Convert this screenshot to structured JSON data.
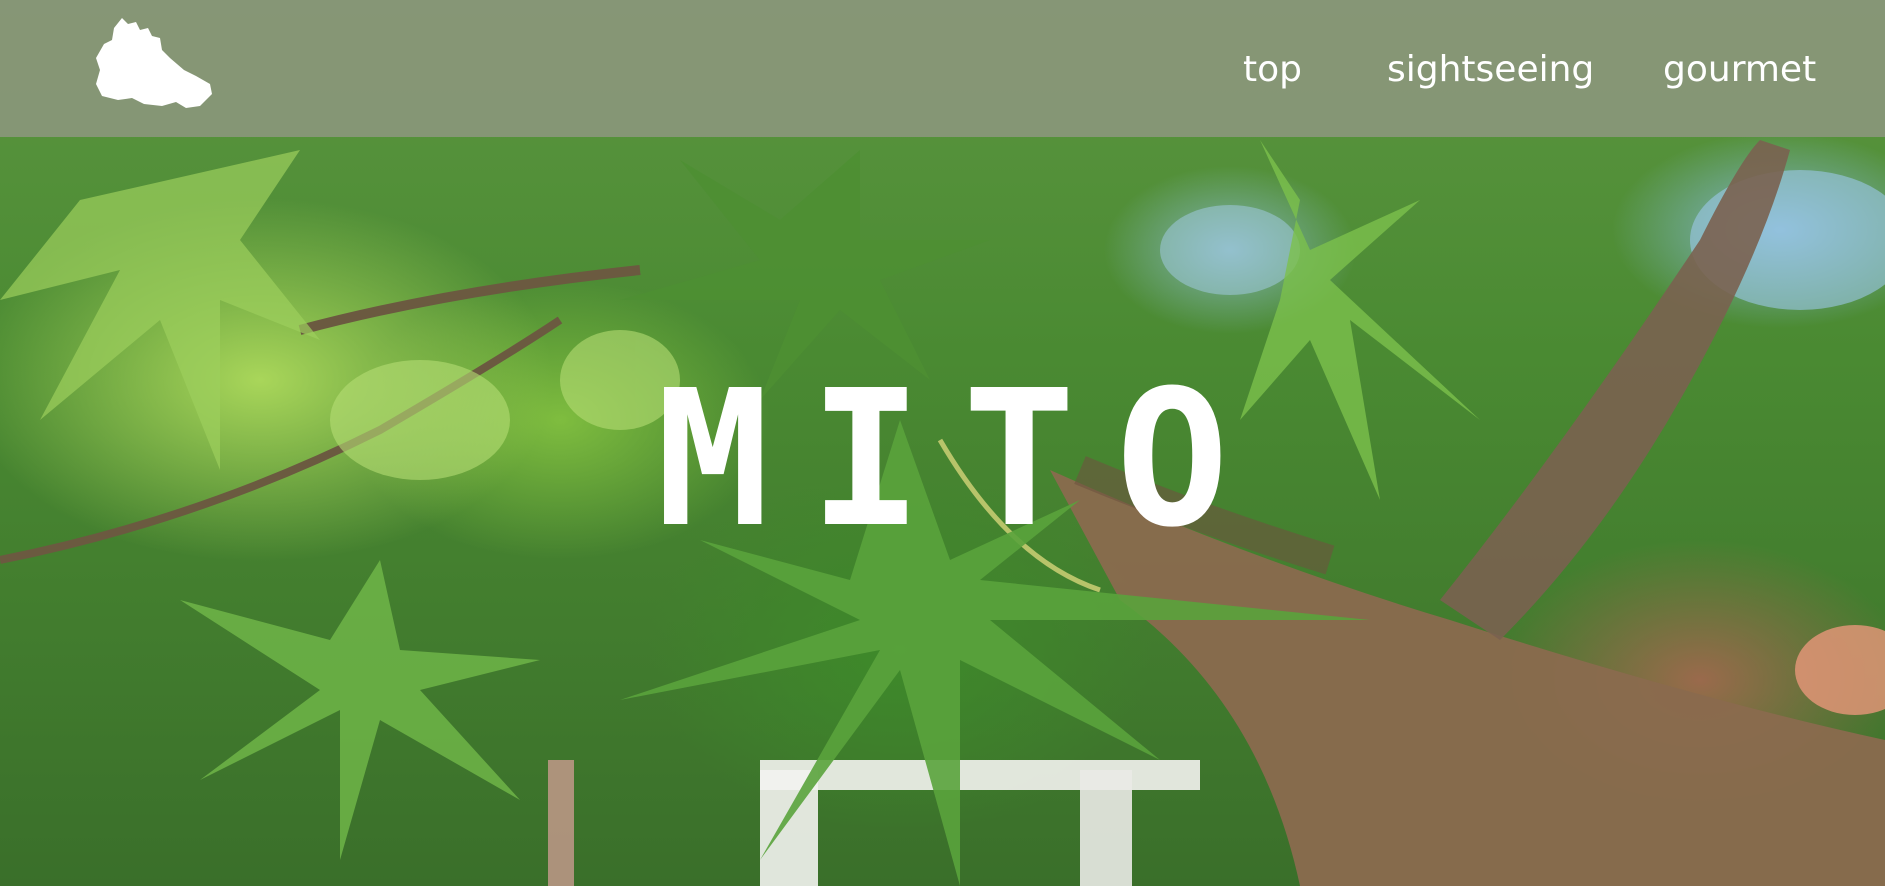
{
  "header": {
    "logo_icon": "ibaraki-map-logo-icon",
    "nav": [
      {
        "label": "top"
      },
      {
        "label": "sightseeing"
      },
      {
        "label": "gourmet"
      }
    ]
  },
  "hero": {
    "title": "MITO",
    "background": "green-maple-leaves-photo"
  },
  "colors": {
    "header_overlay": "#8c967d",
    "text": "#ffffff"
  }
}
